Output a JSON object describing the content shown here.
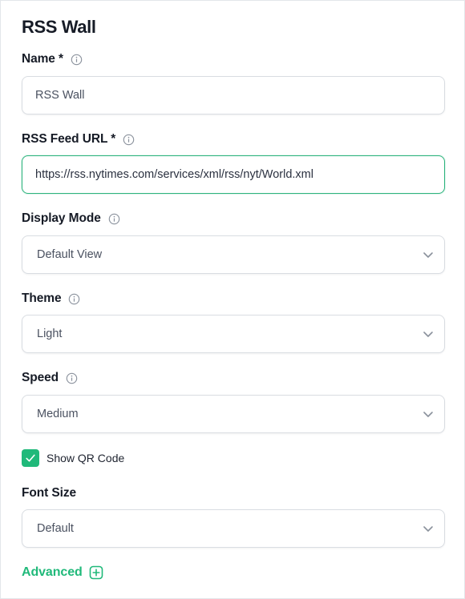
{
  "page": {
    "title": "RSS Wall"
  },
  "fields": {
    "name": {
      "label": "Name *",
      "value": "RSS Wall"
    },
    "rss_url": {
      "label": "RSS Feed URL *",
      "value": "https://rss.nytimes.com/services/xml/rss/nyt/World.xml"
    },
    "display_mode": {
      "label": "Display Mode",
      "selected": "Default View"
    },
    "theme": {
      "label": "Theme",
      "selected": "Light"
    },
    "speed": {
      "label": "Speed",
      "selected": "Medium"
    },
    "show_qr": {
      "label": "Show QR Code",
      "checked": true
    },
    "font_size": {
      "label": "Font Size",
      "selected": "Default"
    }
  },
  "advanced": {
    "label": "Advanced"
  },
  "icons": {
    "info": "info-icon",
    "chevron": "chevron-down-icon",
    "check": "check-icon",
    "plus": "plus-square-icon"
  },
  "colors": {
    "accent": "#20b97a",
    "focus_border": "#2fb47e",
    "text_dark": "#161b26",
    "text_muted": "#4a5160",
    "border": "#d9dde2"
  }
}
